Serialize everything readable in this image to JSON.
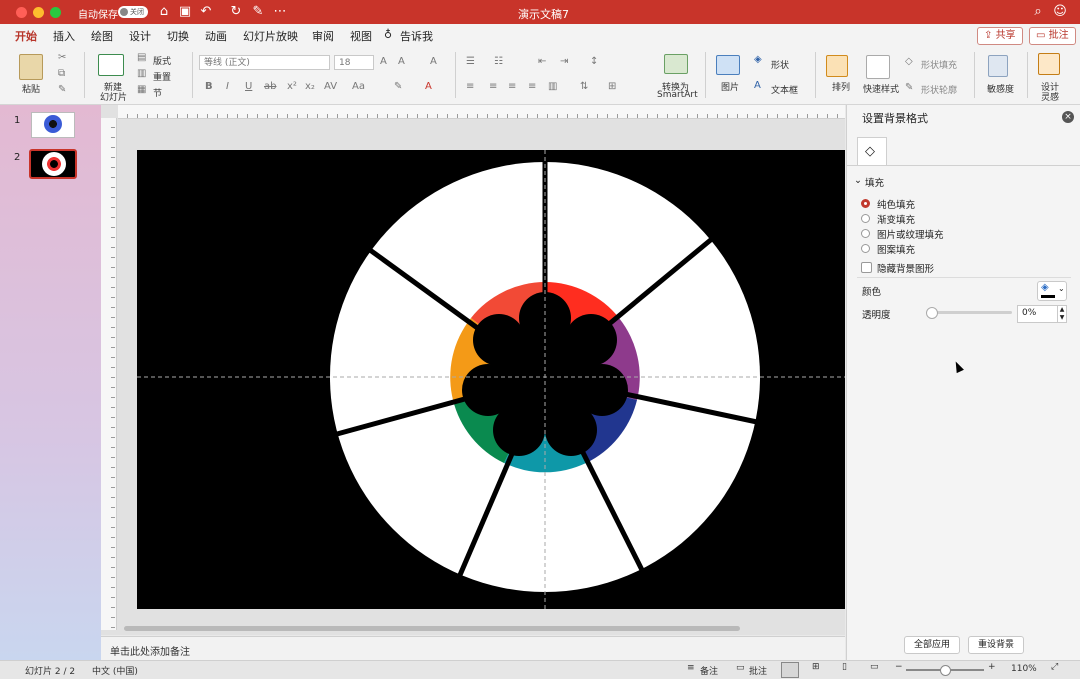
{
  "window": {
    "title": "演示文稿7",
    "autosave_label": "自动保存",
    "autosave_state": "关闭"
  },
  "menu": {
    "tabs": [
      "开始",
      "插入",
      "绘图",
      "设计",
      "切换",
      "动画",
      "幻灯片放映",
      "审阅",
      "视图"
    ],
    "tell_me": "告诉我",
    "share": "共享",
    "comments": "批注"
  },
  "ribbon": {
    "paste": "粘贴",
    "new_slide_line1": "新建",
    "new_slide_line2": "幻灯片",
    "layout": "版式",
    "reset": "重置",
    "section": "节",
    "font_name": "等线 (正文)",
    "font_size": "18",
    "convert_smartart_line1": "转换为",
    "convert_smartart_line2": "SmartArt",
    "picture": "图片",
    "shapes": "形状",
    "textbox": "文本框",
    "arrange": "排列",
    "quick_styles": "快速样式",
    "shape_fill": "形状填充",
    "shape_outline": "形状轮廓",
    "sensitivity": "敏感度",
    "designer_line1": "设计",
    "designer_line2": "灵感"
  },
  "thumbnails": [
    {
      "number": "1"
    },
    {
      "number": "2"
    }
  ],
  "notes_placeholder": "单击此处添加备注",
  "status": {
    "slide_info": "幻灯片 2 / 2",
    "language": "中文 (中国)",
    "notes": "备注",
    "comments": "批注",
    "zoom": "110%"
  },
  "format_panel": {
    "title": "设置背景格式",
    "section": "填充",
    "fill_options": [
      "纯色填充",
      "渐变填充",
      "图片或纹理填充",
      "图案填充"
    ],
    "selected_fill": "纯色填充",
    "hide_background": "隐藏背景图形",
    "color_label": "颜色",
    "transparency_label": "透明度",
    "transparency_value": "0%",
    "apply_all": "全部应用",
    "reset_background": "重设背景"
  },
  "colors": {
    "accent": "#c8342a",
    "ring": [
      "#ff2d1f",
      "#8e3a8c",
      "#21368f",
      "#0e98a8",
      "#0a8a4f",
      "#f49a17",
      "#f24a36"
    ]
  }
}
